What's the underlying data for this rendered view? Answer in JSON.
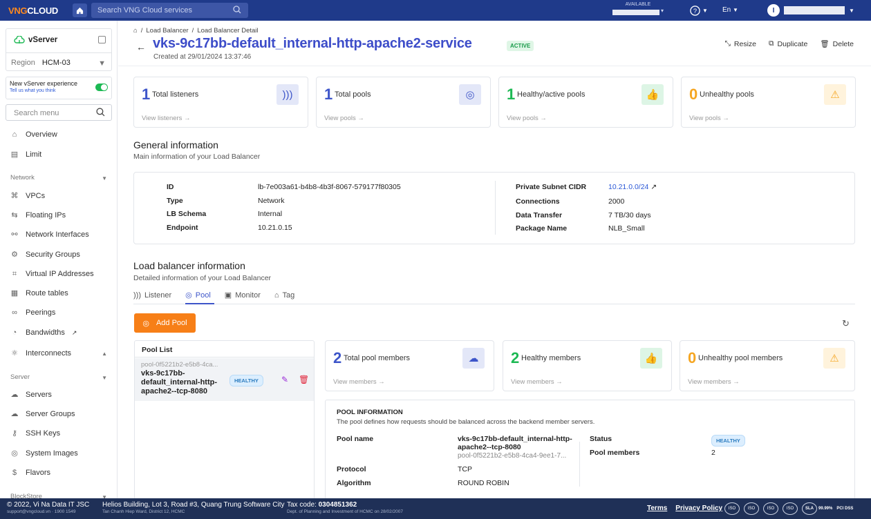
{
  "topbar": {
    "logo_a": "VNG",
    "logo_b": "CLOUD",
    "search_placeholder": "Search VNG Cloud services",
    "available": "AVAILABLE",
    "lang": "En",
    "user_initial": "I"
  },
  "sidebar": {
    "service": "vServer",
    "region_label": "Region",
    "region": "HCM-03",
    "new_exp": "New vServer experience",
    "new_exp_link": "Tell us what you think",
    "search_placeholder": "Search menu",
    "items": [
      {
        "label": "Overview",
        "icon": "home-icon"
      },
      {
        "label": "Limit",
        "icon": "limit-icon"
      },
      {
        "label": "Network",
        "section": true
      },
      {
        "label": "VPCs",
        "icon": "vpc-icon"
      },
      {
        "label": "Floating IPs",
        "icon": "floating-ip-icon"
      },
      {
        "label": "Network Interfaces",
        "icon": "network-interface-icon"
      },
      {
        "label": "Security Groups",
        "icon": "security-group-icon"
      },
      {
        "label": "Virtual IP Addresses",
        "icon": "virtual-ip-icon"
      },
      {
        "label": "Route tables",
        "icon": "route-table-icon"
      },
      {
        "label": "Peerings",
        "icon": "peering-icon"
      },
      {
        "label": "Bandwidths",
        "icon": "bandwidth-icon"
      },
      {
        "label": "Interconnects",
        "icon": "interconnect-icon"
      },
      {
        "label": "Server",
        "section": true
      },
      {
        "label": "Servers",
        "icon": "server-icon"
      },
      {
        "label": "Server Groups",
        "icon": "server-group-icon"
      },
      {
        "label": "SSH Keys",
        "icon": "key-icon"
      },
      {
        "label": "System Images",
        "icon": "image-icon"
      },
      {
        "label": "Flavors",
        "icon": "flavor-icon"
      },
      {
        "label": "BlockStore",
        "section": true
      }
    ]
  },
  "breadcrumb": {
    "a": "Load Balancer",
    "b": "Load Balancer Detail"
  },
  "page": {
    "title": "vks-9c17bb-default_internal-http-apache2-service",
    "status": "ACTIVE",
    "created": "Created at 29/01/2024 13:37:46"
  },
  "actions": {
    "resize": "Resize",
    "duplicate": "Duplicate",
    "delete": "Delete"
  },
  "stats": [
    {
      "num": "1",
      "label": "Total listeners",
      "foot": "View listeners →"
    },
    {
      "num": "1",
      "label": "Total pools",
      "foot": "View pools →"
    },
    {
      "num": "1",
      "label": "Healthy/active pools",
      "foot": "View pools →"
    },
    {
      "num": "0",
      "label": "Unhealthy pools",
      "foot": "View pools →"
    }
  ],
  "general": {
    "title": "General information",
    "subtitle": "Main information of your Load Balancer",
    "left": [
      [
        "ID",
        "lb-7e003a61-b4b8-4b3f-8067-579177f80305"
      ],
      [
        "Type",
        "Network"
      ],
      [
        "LB Schema",
        "Internal"
      ],
      [
        "Endpoint",
        "10.21.0.15"
      ]
    ],
    "right": [
      [
        "Private Subnet CIDR",
        "10.21.0.0/24"
      ],
      [
        "Connections",
        "2000"
      ],
      [
        "Data Transfer",
        "7 TB/30 days"
      ],
      [
        "Package Name",
        "NLB_Small"
      ]
    ]
  },
  "lbinfo": {
    "title": "Load balancer information",
    "subtitle": "Detailed information of your Load Balancer"
  },
  "tabs": [
    "Listener",
    "Pool",
    "Monitor",
    "Tag"
  ],
  "add_pool": "Add Pool",
  "pool_list": {
    "title": "Pool List",
    "id": "pool-0f5221b2-e5b8-4ca...",
    "name": "vks-9c17bb-default_internal-http-apache2--tcp-8080",
    "status": "HEALTHY"
  },
  "pool_stats": [
    {
      "num": "2",
      "label": "Total pool members",
      "foot": "View members →"
    },
    {
      "num": "2",
      "label": "Healthy members",
      "foot": "View members →"
    },
    {
      "num": "0",
      "label": "Unhealthy pool members",
      "foot": "View members →"
    }
  ],
  "pool_info": {
    "title": "POOL INFORMATION",
    "desc": "The pool defines how requests should be balanced across the backend member servers.",
    "name_label": "Pool name",
    "name": "vks-9c17bb-default_internal-http-apache2--tcp-8080",
    "name_id": "pool-0f5221b2-e5b8-4ca4-9ee1-7...",
    "protocol_label": "Protocol",
    "protocol": "TCP",
    "algorithm_label": "Algorithm",
    "algorithm": "ROUND ROBIN",
    "status_label": "Status",
    "status": "HEALTHY",
    "members_label": "Pool members",
    "members": "2"
  },
  "footer": {
    "copy": "© 2022, Vi Na Data IT JSC",
    "copy_sub": "support@vngcloud.vn · 1900 1549",
    "addr": "Helios Building, Lot 3, Road #3, Quang Trung Software City",
    "addr_sub": "Tan Chanh Hiep Ward, District 12, HCMC",
    "tax_label": "Tax code:",
    "tax": "0304851362",
    "tax_sub": "Dept. of Planning and Investment of HCMC on 28/02/2007",
    "terms": "Terms",
    "privacy": "Privacy Policy",
    "sla": "SLA",
    "sla_pct": "99.99%",
    "pci": "PCI DSS"
  }
}
